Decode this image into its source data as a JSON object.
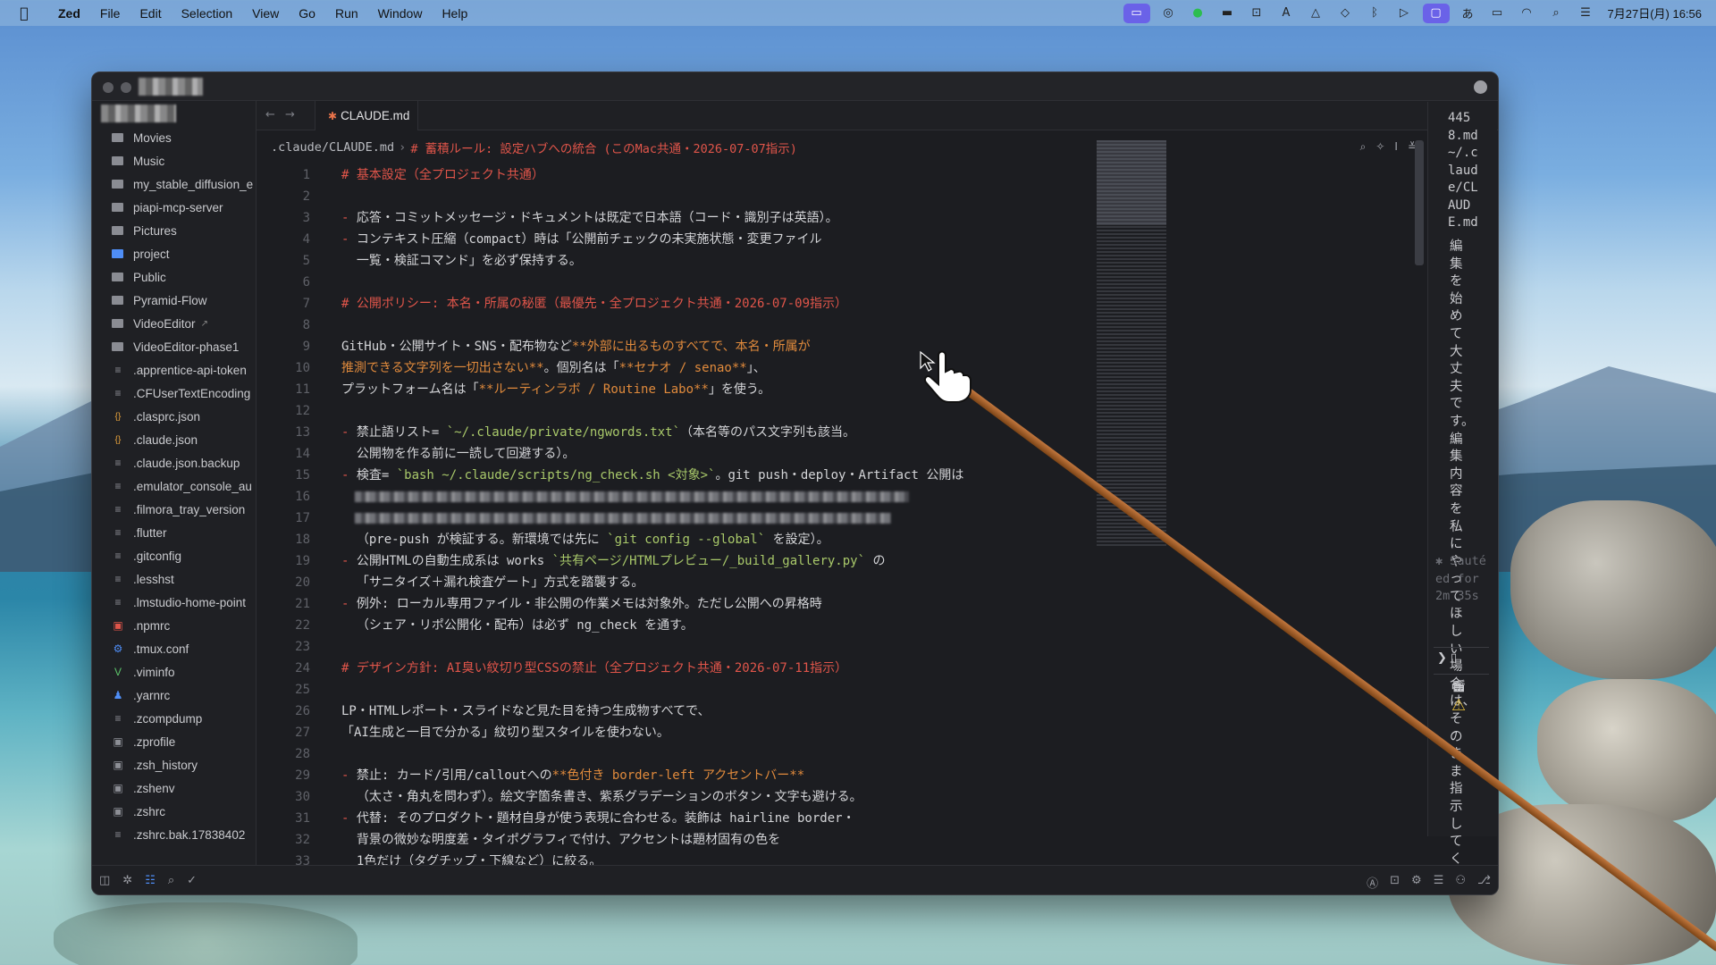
{
  "menubar": {
    "app": "Zed",
    "items": [
      "File",
      "Edit",
      "Selection",
      "View",
      "Go",
      "Run",
      "Window",
      "Help"
    ],
    "clock": "7月27日(月) 16:56"
  },
  "sidebar": {
    "items": [
      {
        "label": "Movies",
        "icon": "folder-icon"
      },
      {
        "label": "Music",
        "icon": "folder-icon"
      },
      {
        "label": "my_stable_diffusion_e",
        "icon": "folder-icon"
      },
      {
        "label": "piapi-mcp-server",
        "icon": "folder-icon"
      },
      {
        "label": "Pictures",
        "icon": "folder-icon"
      },
      {
        "label": "project",
        "icon": "project-folder-icon"
      },
      {
        "label": "Public",
        "icon": "folder-icon"
      },
      {
        "label": "Pyramid-Flow",
        "icon": "folder-icon"
      },
      {
        "label": "VideoEditor",
        "icon": "folder-icon",
        "symlink": true
      },
      {
        "label": "VideoEditor-phase1",
        "icon": "folder-icon"
      },
      {
        "label": ".apprentice-api-token",
        "icon": "file-icon"
      },
      {
        "label": ".CFUserTextEncoding",
        "icon": "file-icon"
      },
      {
        "label": ".clasprc.json",
        "icon": "json-icon"
      },
      {
        "label": ".claude.json",
        "icon": "json-icon"
      },
      {
        "label": ".claude.json.backup",
        "icon": "file-icon"
      },
      {
        "label": ".emulator_console_au",
        "icon": "file-icon"
      },
      {
        "label": ".filmora_tray_version",
        "icon": "file-icon"
      },
      {
        "label": ".flutter",
        "icon": "file-icon"
      },
      {
        "label": ".gitconfig",
        "icon": "file-icon"
      },
      {
        "label": ".lesshst",
        "icon": "file-icon"
      },
      {
        "label": ".lmstudio-home-point",
        "icon": "file-icon"
      },
      {
        "label": ".npmrc",
        "icon": "npm-icon"
      },
      {
        "label": ".tmux.conf",
        "icon": "gear-icon"
      },
      {
        "label": ".viminfo",
        "icon": "vim-icon"
      },
      {
        "label": ".yarnrc",
        "icon": "yarn-icon"
      },
      {
        "label": ".zcompdump",
        "icon": "file-icon"
      },
      {
        "label": ".zprofile",
        "icon": "terminal-icon"
      },
      {
        "label": ".zsh_history",
        "icon": "terminal-icon"
      },
      {
        "label": ".zshenv",
        "icon": "terminal-icon"
      },
      {
        "label": ".zshrc",
        "icon": "terminal-icon"
      },
      {
        "label": ".zshrc.bak.17838402",
        "icon": "file-icon"
      }
    ]
  },
  "tab": {
    "label": "CLAUDE.md"
  },
  "breadcrumb": {
    "file": ".claude/CLAUDE.md",
    "section": "# 蓄積ルール: 設定ハブへの統合 (このMac共通・2026-07-07指示)"
  },
  "editor": {
    "lines": [
      {
        "n": "1",
        "segs": [
          {
            "t": "# 基本設定（全プロジェクト共通）",
            "c": "h"
          }
        ]
      },
      {
        "n": "2",
        "segs": []
      },
      {
        "n": "3",
        "segs": [
          {
            "t": "- ",
            "c": "m"
          },
          {
            "t": "応答・コミットメッセージ・ドキュメントは既定で日本語（コード・識別子は英語）。"
          }
        ]
      },
      {
        "n": "4",
        "segs": [
          {
            "t": "- ",
            "c": "m"
          },
          {
            "t": "コンテキスト圧縮（compact）時は「公開前チェックの未実施状態・変更ファイル"
          }
        ]
      },
      {
        "n": "5",
        "segs": [
          {
            "t": "  一覧・検証コマンド」を必ず保持する。"
          }
        ]
      },
      {
        "n": "6",
        "segs": []
      },
      {
        "n": "7",
        "segs": [
          {
            "t": "# 公開ポリシー: 本名・所属の秘匿（最優先・全プロジェクト共通・2026-07-09指示）",
            "c": "h"
          }
        ]
      },
      {
        "n": "8",
        "segs": []
      },
      {
        "n": "9",
        "segs": [
          {
            "t": "GitHub・公開サイト・SNS・配布物など"
          },
          {
            "t": "**外部に出るものすべてで、本名・所属が",
            "c": "b"
          }
        ]
      },
      {
        "n": "10",
        "segs": [
          {
            "t": "推測できる文字列を一切出さない**",
            "c": "b"
          },
          {
            "t": "。個別名は「"
          },
          {
            "t": "**セナオ / senao**",
            "c": "b"
          },
          {
            "t": "」、"
          }
        ]
      },
      {
        "n": "11",
        "segs": [
          {
            "t": "プラットフォーム名は「"
          },
          {
            "t": "**ルーティンラボ / Routine Labo**",
            "c": "b"
          },
          {
            "t": "」を使う。"
          }
        ]
      },
      {
        "n": "12",
        "segs": []
      },
      {
        "n": "13",
        "segs": [
          {
            "t": "- ",
            "c": "m"
          },
          {
            "t": "禁止語リスト= "
          },
          {
            "t": "`~/.claude/private/ngwords.txt`",
            "c": "c"
          },
          {
            "t": "（本名等のパス文字列も該当。"
          }
        ]
      },
      {
        "n": "14",
        "segs": [
          {
            "t": "  公開物を作る前に一読して回避する）。"
          }
        ]
      },
      {
        "n": "15",
        "segs": [
          {
            "t": "- ",
            "c": "m"
          },
          {
            "t": "検査= "
          },
          {
            "t": "`bash ~/.claude/scripts/ng_check.sh <対象>`",
            "c": "c"
          },
          {
            "t": "。git push・deploy・Artifact 公開は"
          }
        ]
      },
      {
        "n": "16",
        "segs": [],
        "redact": [
          [
            14,
            0,
            620
          ]
        ]
      },
      {
        "n": "17",
        "segs": [],
        "redact": [
          [
            14,
            0,
            600
          ]
        ]
      },
      {
        "n": "18",
        "segs": [
          {
            "t": "  （pre-push が検証する。新環境では先に "
          },
          {
            "t": "`git config --global`",
            "c": "c"
          },
          {
            "t": " を設定）。"
          }
        ]
      },
      {
        "n": "19",
        "segs": [
          {
            "t": "- ",
            "c": "m"
          },
          {
            "t": "公開HTMLの自動生成系は works "
          },
          {
            "t": "`共有ページ/HTMLプレビュー/_build_gallery.py`",
            "c": "c"
          },
          {
            "t": " の"
          }
        ]
      },
      {
        "n": "20",
        "segs": [
          {
            "t": "  「サニタイズ＋漏れ検査ゲート」方式を踏襲する。"
          }
        ]
      },
      {
        "n": "21",
        "segs": [
          {
            "t": "- ",
            "c": "m"
          },
          {
            "t": "例外: ローカル専用ファイル・非公開の作業メモは対象外。ただし公開への昇格時"
          }
        ]
      },
      {
        "n": "22",
        "segs": [
          {
            "t": "  （シェア・リポ公開化・配布）は必ず ng_check を通す。"
          }
        ]
      },
      {
        "n": "23",
        "segs": []
      },
      {
        "n": "24",
        "segs": [
          {
            "t": "# デザイン方針: AI臭い紋切り型CSSの禁止（全プロジェクト共通・2026-07-11指示）",
            "c": "h"
          }
        ]
      },
      {
        "n": "25",
        "segs": []
      },
      {
        "n": "26",
        "segs": [
          {
            "t": "LP・HTMLレポート・スライドなど見た目を持つ生成物すべてで、"
          }
        ]
      },
      {
        "n": "27",
        "segs": [
          {
            "t": "「AI生成と一目で分かる」紋切り型スタイルを使わない。"
          }
        ]
      },
      {
        "n": "28",
        "segs": []
      },
      {
        "n": "29",
        "segs": [
          {
            "t": "- ",
            "c": "m"
          },
          {
            "t": "禁止: カード/引用/calloutへの"
          },
          {
            "t": "**色付き border-left アクセントバー**",
            "c": "b"
          }
        ]
      },
      {
        "n": "30",
        "segs": [
          {
            "t": "  （太さ・角丸を問わず）。絵文字箇条書き、紫系グラデーションのボタン・文字も避ける。"
          }
        ]
      },
      {
        "n": "31",
        "segs": [
          {
            "t": "- ",
            "c": "m"
          },
          {
            "t": "代替: そのプロダクト・題材自身が使う表現に合わせる。装飾は hairline border・"
          }
        ]
      },
      {
        "n": "32",
        "segs": [
          {
            "t": "  背景の微妙な明度差・タイポグラフィで付け、アクセントは題材固有の色を"
          }
        ]
      },
      {
        "n": "33",
        "segs": [
          {
            "t": "  1色だけ（タグチップ・下線など）に絞る。"
          }
        ]
      }
    ]
  },
  "right_panel": {
    "path": "4458.md ~/.claude/CLAUDE.md",
    "message": "編集を始めて大丈夫です。編集内容を私にやってほしい場合は、そのまま指示してください。",
    "status": "✱ Sautéed for 2m 35s"
  },
  "colors": {
    "accent": "#4f8ef7",
    "heading": "#e0554a",
    "bold": "#e08a3c",
    "code": "#a9c96a",
    "bg": "#1c1d21"
  }
}
